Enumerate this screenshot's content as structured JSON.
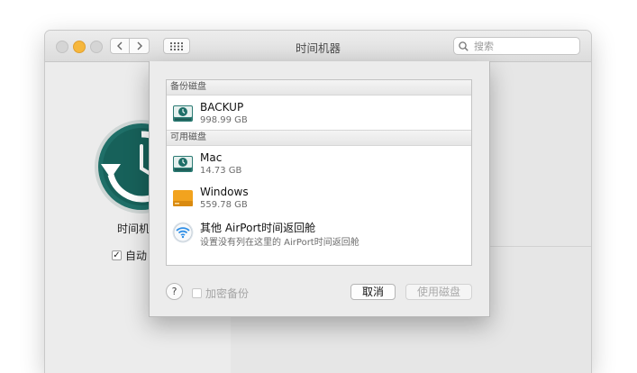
{
  "window": {
    "title": "时间机器",
    "search": {
      "placeholder": "搜索",
      "value": ""
    }
  },
  "left_pane": {
    "app_label": "时间机",
    "auto_backup": {
      "label": "自动",
      "checked": true
    }
  },
  "sheet": {
    "sections": [
      {
        "header": "备份磁盘",
        "items": [
          {
            "name": "BACKUP",
            "detail": "998.99 GB",
            "icon": "time-machine-disk-icon"
          }
        ]
      },
      {
        "header": "可用磁盘",
        "items": [
          {
            "name": "Mac",
            "detail": "14.73 GB",
            "icon": "time-machine-disk-icon"
          },
          {
            "name": "Windows",
            "detail": "559.78 GB",
            "icon": "external-drive-icon"
          },
          {
            "name": "其他 AirPort时间返回舱",
            "detail": "设置没有列在这里的 AirPort时间返回舱",
            "icon": "airport-wifi-icon"
          }
        ]
      }
    ],
    "help_label": "?",
    "encrypt": {
      "label": "加密备份",
      "checked": false
    },
    "cancel_label": "取消",
    "use_disk_label": "使用磁盘"
  },
  "colors": {
    "tm_green": "#1f6f68",
    "drive_orange": "#f2a31e",
    "wifi_blue": "#2f8fe6"
  }
}
